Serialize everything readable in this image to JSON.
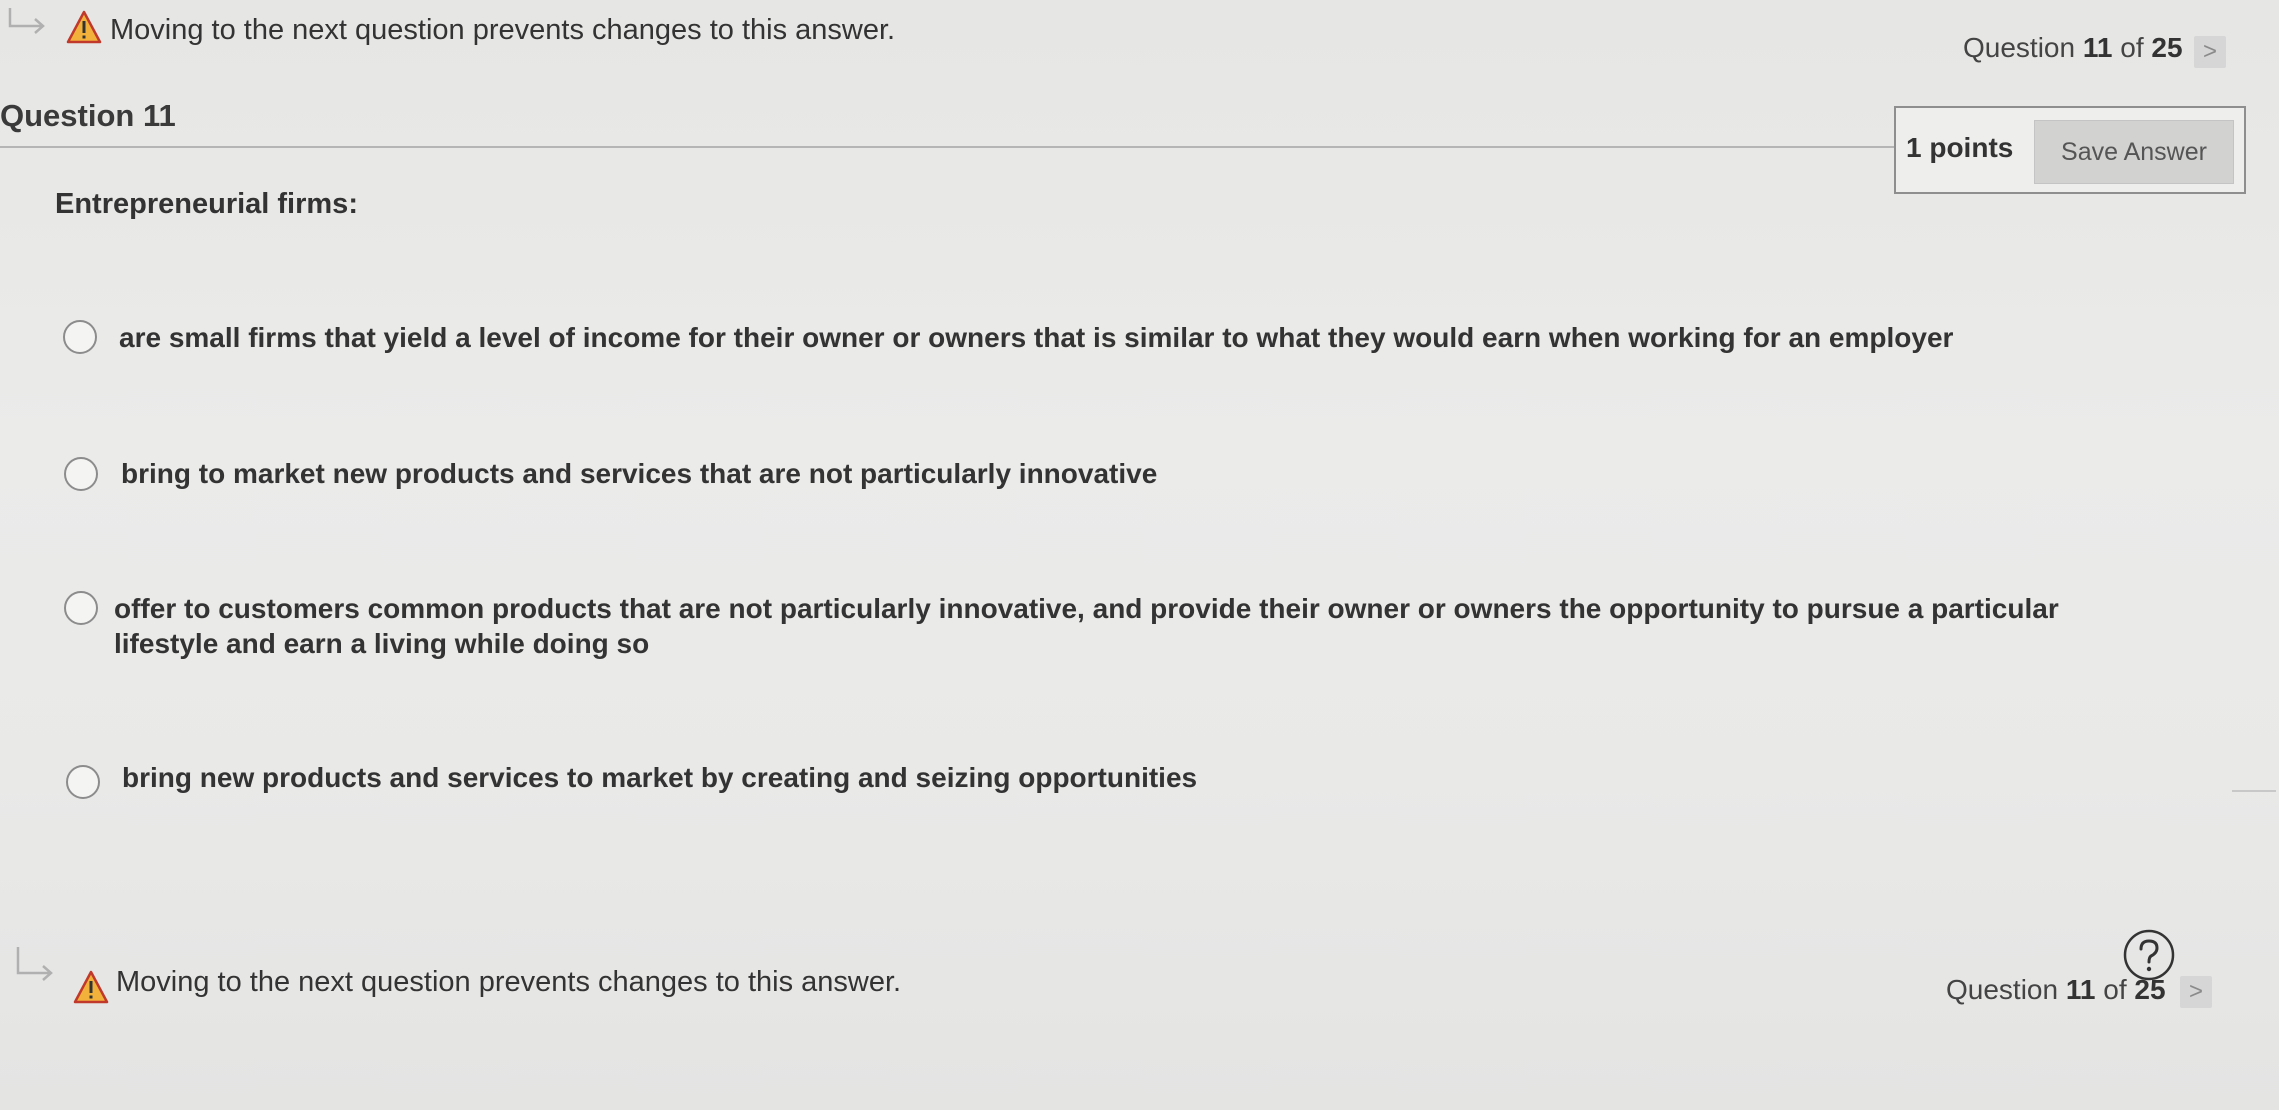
{
  "top_bar": {
    "warning": "Moving to the next question prevents changes to this answer.",
    "counter_prefix": "Question",
    "counter_current": "11",
    "counter_of": "of",
    "counter_total": "25",
    "next_glyph": ">"
  },
  "question": {
    "title": "Question 11",
    "points": "1 points",
    "save_label": "Save Answer",
    "prompt": "Entrepreneurial firms:",
    "options": [
      "are small firms that yield a level of income for their owner or owners that is similar to what they would earn when working for an employer",
      "bring to market new products and services that are not particularly innovative",
      "offer to customers common products that are not particularly innovative, and provide their owner or owners the opportunity to pursue a particular lifestyle and earn a living while doing so",
      "bring new products and services to market by creating and seizing opportunities"
    ]
  },
  "bottom_bar": {
    "warning": "Moving to the next question prevents changes to this answer.",
    "counter_prefix": "Question",
    "counter_current": "11",
    "counter_of": "of",
    "counter_total": "25",
    "next_glyph": ">"
  },
  "icons": {
    "warning": "warning-triangle-icon",
    "nav": "return-arrow-icon",
    "help": "help-icon"
  },
  "colors": {
    "warning_fill": "#f2b13a",
    "warning_stroke": "#c0392b"
  }
}
